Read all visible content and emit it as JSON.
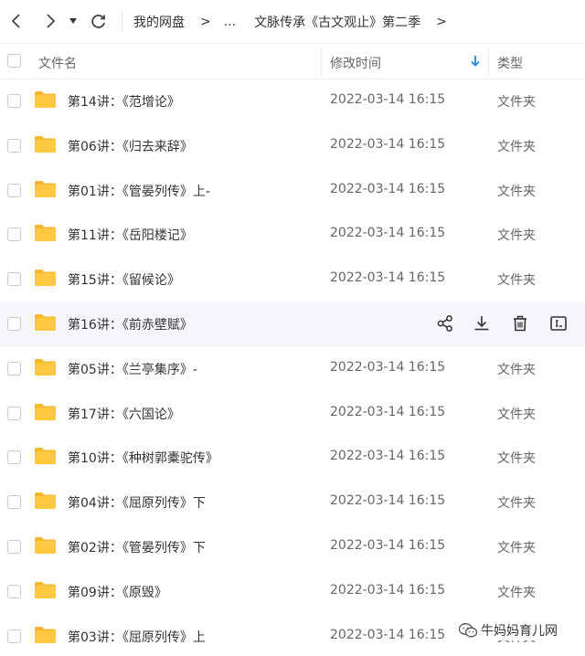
{
  "toolbar": {
    "back_icon": "chevron-left-icon",
    "forward_icon": "chevron-right-icon",
    "history_icon": "caret-down-icon",
    "refresh_icon": "refresh-icon",
    "breadcrumb": [
      {
        "label": "我的网盘"
      },
      {
        "label": "..."
      },
      {
        "label": "文脉传承《古文观止》第二季"
      }
    ],
    "crumb_sep": ">"
  },
  "header": {
    "name": "文件名",
    "time": "修改时间",
    "type": "类型",
    "sort_icon": "sort-down-arrow-icon",
    "sort_color": "#1e88e5"
  },
  "colors": {
    "folder": "#ffc93f",
    "folder_dark": "#f5b82e",
    "hover_bg": "#f5f6fa"
  },
  "files": [
    {
      "name": "第14讲：《范增论》",
      "time": "2022-03-14 16:15",
      "type": "文件夹"
    },
    {
      "name": "第06讲：《归去来辞》",
      "time": "2022-03-14 16:15",
      "type": "文件夹"
    },
    {
      "name": "第01讲：《管晏列传》上-",
      "time": "2022-03-14 16:15",
      "type": "文件夹"
    },
    {
      "name": "第11讲：《岳阳楼记》",
      "time": "2022-03-14 16:15",
      "type": "文件夹"
    },
    {
      "name": "第15讲：《留候论》",
      "time": "2022-03-14 16:15",
      "type": "文件夹"
    },
    {
      "name": "第16讲：《前赤壁赋》",
      "time": "",
      "type": "",
      "hover": true
    },
    {
      "name": "第05讲：《兰亭集序》-",
      "time": "2022-03-14 16:15",
      "type": "文件夹"
    },
    {
      "name": "第17讲：《六国论》",
      "time": "2022-03-14 16:15",
      "type": "文件夹"
    },
    {
      "name": "第10讲：《种树郭橐驼传》",
      "time": "2022-03-14 16:15",
      "type": "文件夹"
    },
    {
      "name": "第04讲：《屈原列传》下",
      "time": "2022-03-14 16:15",
      "type": "文件夹"
    },
    {
      "name": "第02讲：《管晏列传》下",
      "time": "2022-03-14 16:15",
      "type": "文件夹"
    },
    {
      "name": "第09讲：《原毁》",
      "time": "2022-03-14 16:15",
      "type": "文件夹"
    },
    {
      "name": "第03讲：《屈原列传》上",
      "time": "2022-03-14 16:15",
      "type": "文件夹"
    }
  ],
  "row_actions": [
    "share-icon",
    "download-icon",
    "delete-icon",
    "rename-icon"
  ],
  "watermark": {
    "text": "牛妈妈育儿网",
    "icon": "wechat-icon"
  }
}
